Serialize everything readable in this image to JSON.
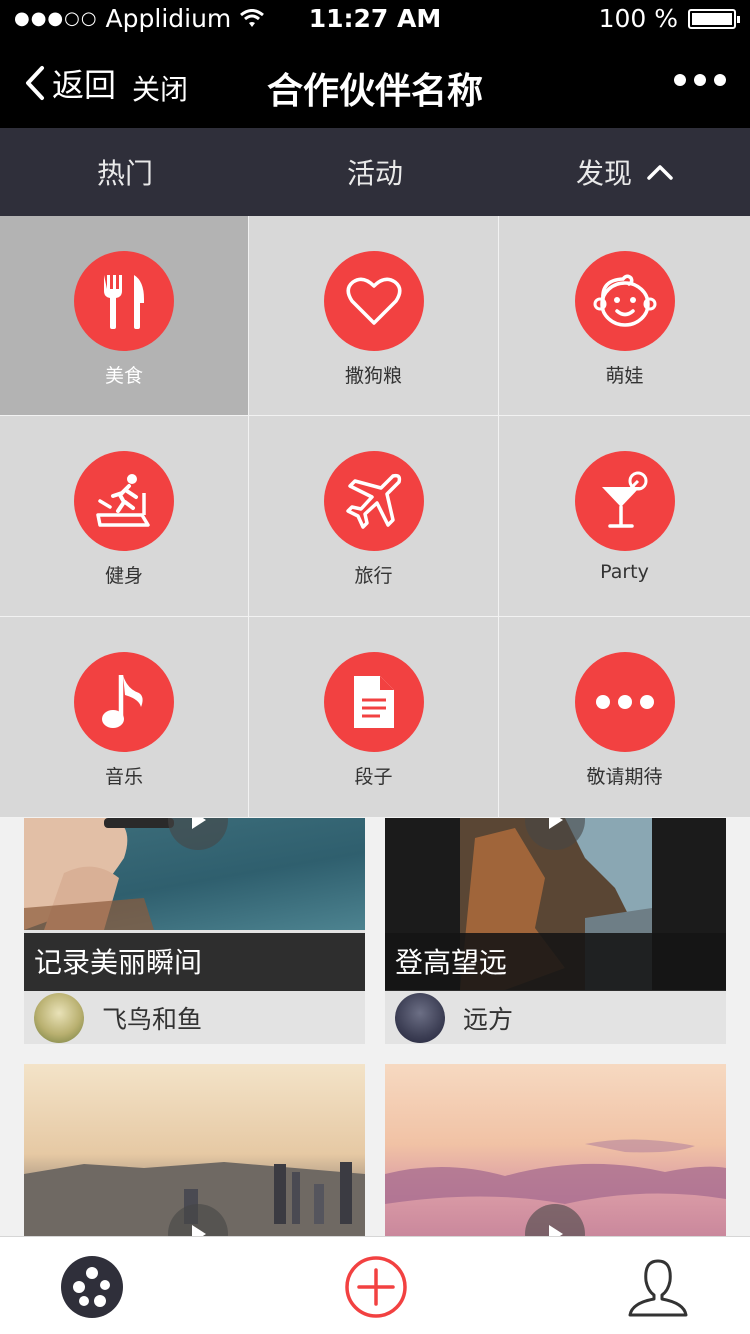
{
  "status_bar": {
    "carrier": "Applidium",
    "signal": "●●●○○",
    "time": "11:27 AM",
    "battery": "100 %"
  },
  "nav": {
    "back_label": "返回",
    "close_label": "关闭",
    "title": "合作伙伴名称"
  },
  "tabs": [
    {
      "label": "热门"
    },
    {
      "label": "活动"
    },
    {
      "label": "发现"
    }
  ],
  "categories": [
    {
      "label": "美食",
      "icon": "fork-knife-icon"
    },
    {
      "label": "撒狗粮",
      "icon": "heart-icon"
    },
    {
      "label": "萌娃",
      "icon": "baby-face-icon"
    },
    {
      "label": "健身",
      "icon": "treadmill-icon"
    },
    {
      "label": "旅行",
      "icon": "airplane-icon"
    },
    {
      "label": "Party",
      "icon": "cocktail-icon"
    },
    {
      "label": "音乐",
      "icon": "music-note-icon"
    },
    {
      "label": "段子",
      "icon": "document-icon"
    },
    {
      "label": "敬请期待",
      "icon": "more-dots-icon"
    }
  ],
  "cards": [
    {
      "caption": "记录美丽瞬间",
      "author": "飞鸟和鱼"
    },
    {
      "caption": "登高望远",
      "author": "远方"
    }
  ],
  "colors": {
    "accent": "#f24141",
    "navbar": "#000000",
    "tabbar": "#2f2f3a",
    "grid_bg": "#d8d8d8",
    "grid_active": "#b3b3b3"
  },
  "bottom_bar": {
    "left_icon": "film-reel-icon",
    "center_icon": "add-circle-icon",
    "right_icon": "user-profile-icon"
  }
}
